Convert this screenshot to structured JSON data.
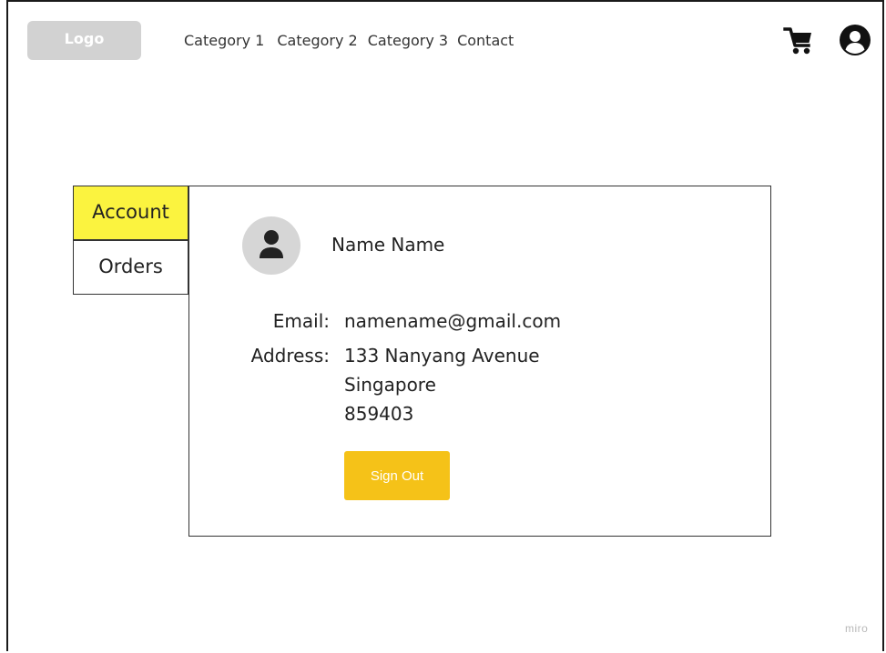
{
  "header": {
    "logo_label": "Logo",
    "nav": [
      {
        "label": "Category 1"
      },
      {
        "label": "Category 2"
      },
      {
        "label": "Category 3"
      },
      {
        "label": "Contact"
      }
    ],
    "icons": {
      "cart": "cart-icon",
      "profile": "user-circle-icon"
    }
  },
  "sidebar": {
    "tabs": [
      {
        "label": "Account",
        "active": true
      },
      {
        "label": "Orders",
        "active": false
      }
    ]
  },
  "account": {
    "name": "Name Name",
    "email_label": "Email:",
    "email": "namename@gmail.com",
    "address_label": "Address:",
    "address_lines": [
      "133 Nanyang Avenue",
      "Singapore",
      "859403"
    ],
    "sign_out_label": "Sign Out"
  },
  "watermark": "miro",
  "colors": {
    "active_tab": "#fbf33f",
    "sign_out_button": "#f5c218",
    "logo_bg": "#d2d2d2",
    "avatar_bg": "#d6d6d6"
  }
}
